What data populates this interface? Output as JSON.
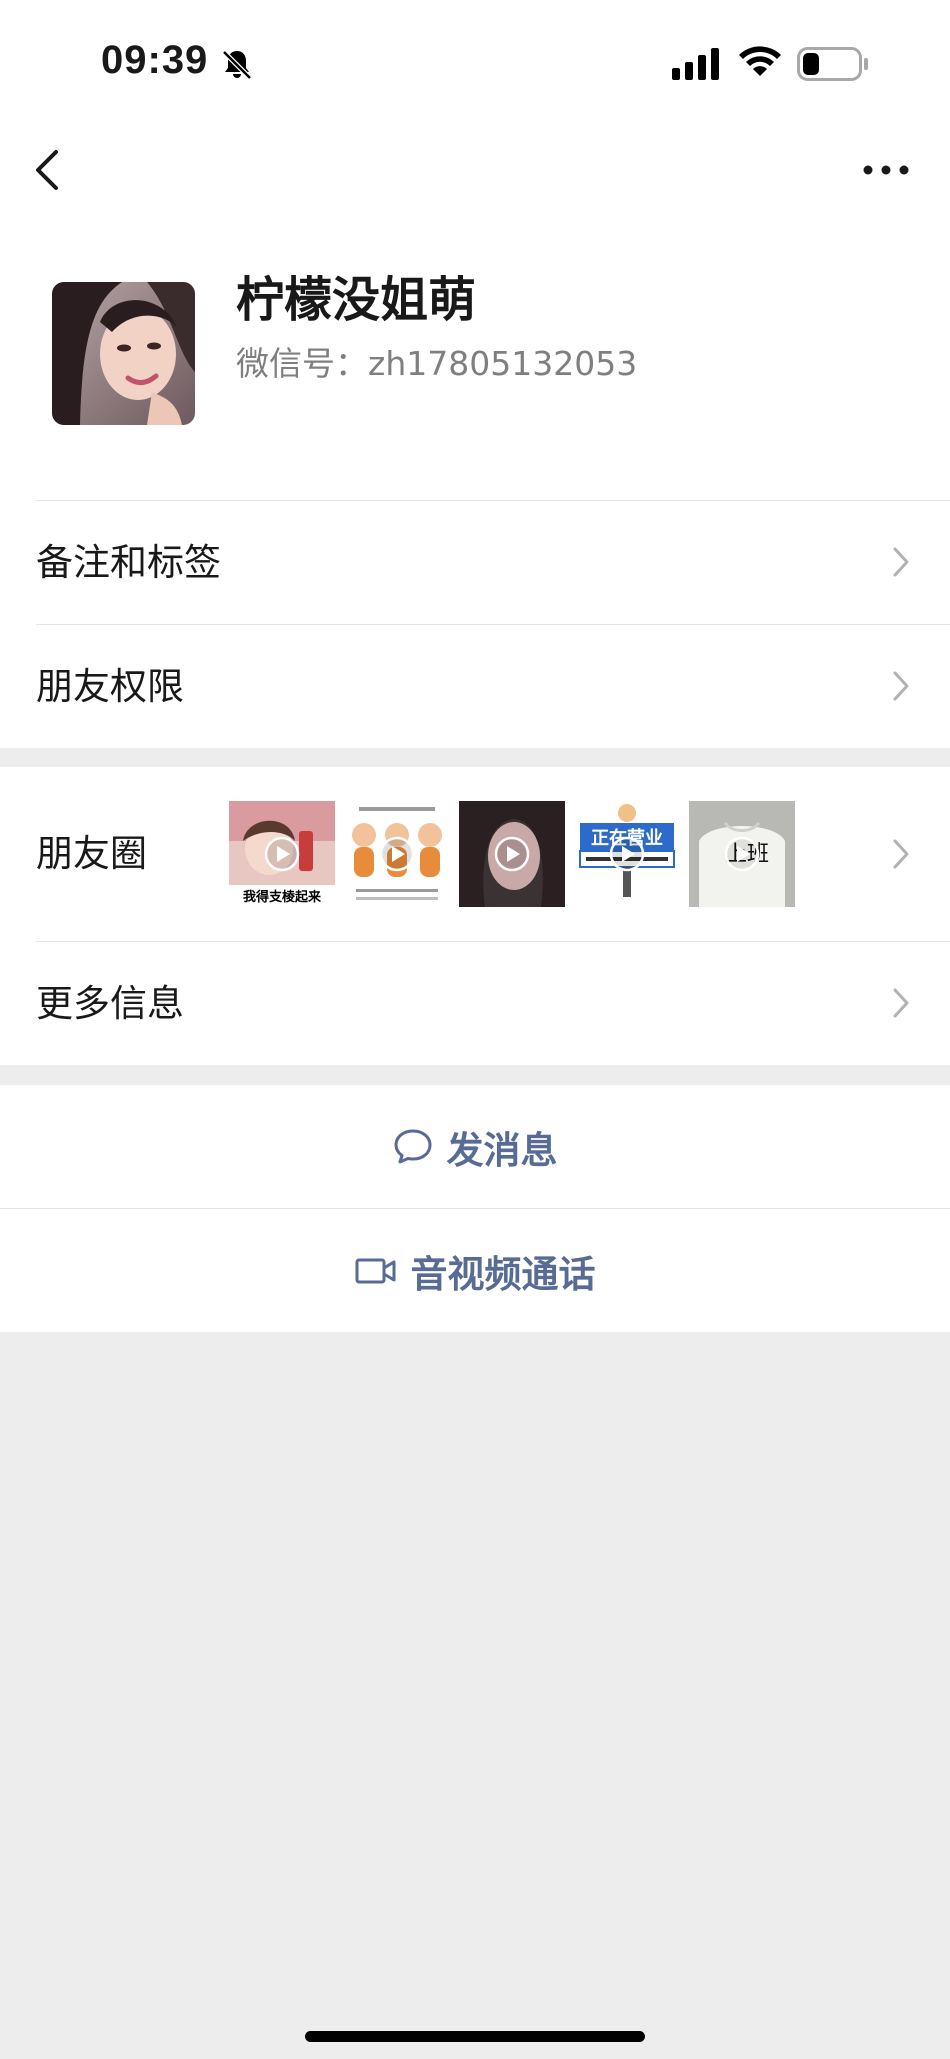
{
  "status_bar": {
    "time": "09:39",
    "battery_level": 0.3
  },
  "profile": {
    "nickname": "柠檬没姐萌",
    "wechat_id": "微信号：zh17805132053"
  },
  "menu": {
    "remarks_tags": "备注和标签",
    "friend_permissions": "朋友权限",
    "moments": "朋友圈",
    "more_info": "更多信息"
  },
  "moments_thumbs": [
    {
      "caption": "我得支棱起来",
      "has_play": true
    },
    {
      "caption": "",
      "has_play": true
    },
    {
      "caption": "",
      "has_play": true
    },
    {
      "caption": "正在营业",
      "has_play": true
    },
    {
      "caption": "上班",
      "has_play": true
    }
  ],
  "actions": {
    "send_message": "发消息",
    "video_call": "音视频通话"
  },
  "colors": {
    "link": "#576b95",
    "background": "#ededed",
    "text": "#191919",
    "secondary": "#7f7f7f"
  }
}
